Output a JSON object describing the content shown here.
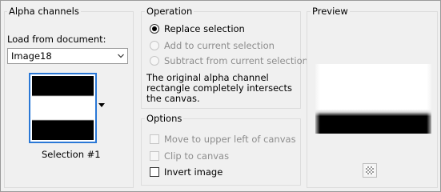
{
  "alpha": {
    "title": "Alpha channels",
    "load_from_document_label": "Load from document:",
    "document_value": "Image18",
    "selection_label": "Selection #1"
  },
  "operation": {
    "title": "Operation",
    "options": [
      {
        "label": "Replace selection",
        "selected": true,
        "enabled": true
      },
      {
        "label": "Add to current selection",
        "selected": false,
        "enabled": false
      },
      {
        "label": "Subtract from current selection",
        "selected": false,
        "enabled": false
      }
    ],
    "description": "The original alpha channel rectangle completely intersects the canvas."
  },
  "options": {
    "title": "Options",
    "items": [
      {
        "label": "Move to upper left of canvas",
        "checked": false,
        "enabled": false
      },
      {
        "label": "Clip to canvas",
        "checked": false,
        "enabled": false
      },
      {
        "label": "Invert image",
        "checked": false,
        "enabled": true
      }
    ]
  },
  "preview": {
    "title": "Preview"
  },
  "icons": {
    "combo_arrow": "chevron-down-icon",
    "thumb_dropdown": "caret-down-icon",
    "checker": "checkerboard-icon"
  },
  "colors": {
    "selected_border": "#2a78d6",
    "disabled_text": "#8d8d8d"
  }
}
